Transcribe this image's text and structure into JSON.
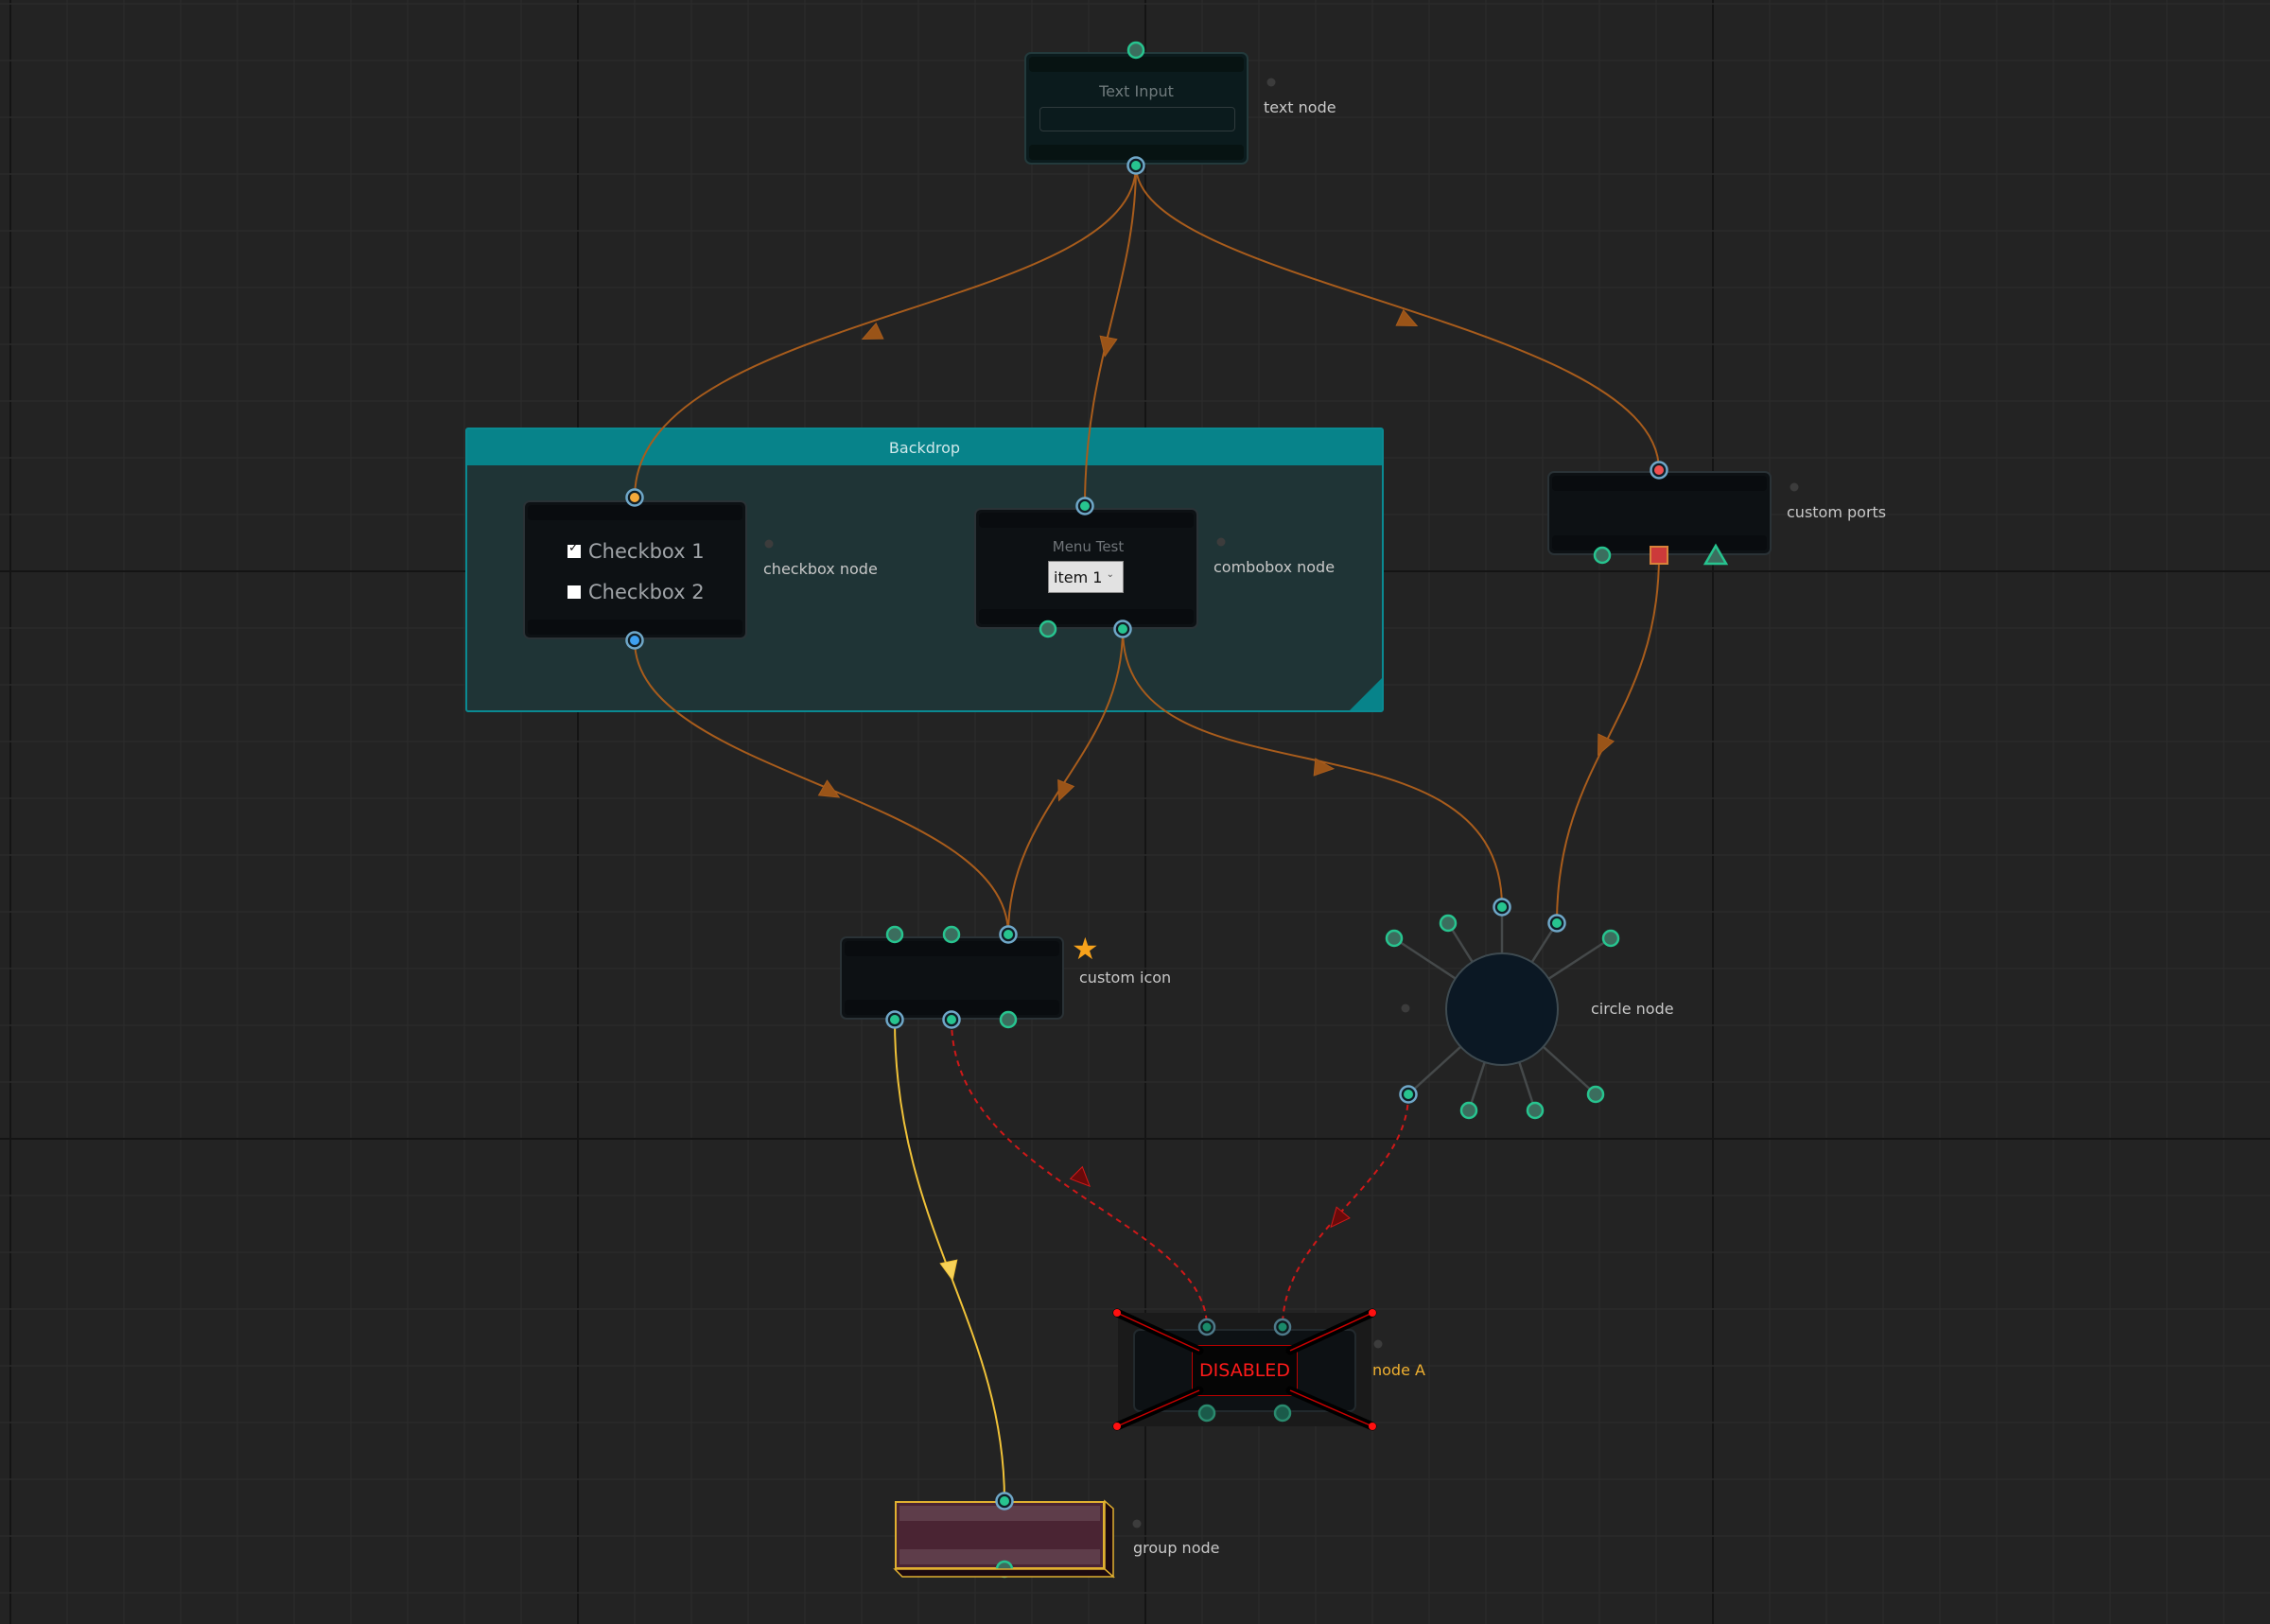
{
  "canvas": {
    "background": "#232323",
    "grid_minor_color": "#2b2b2b",
    "grid_major_color": "#141414"
  },
  "colors": {
    "pipe_orange": "#a85c1c",
    "pipe_yellow": "#f0c238",
    "pipe_disabled": "#d01818",
    "port_green": "#27c48f",
    "port_fill_dark": "#3b6e5e",
    "port_ring_blue": "#6fa7c8",
    "port_orange": "#f5a93a",
    "port_blue": "#3ea0f0",
    "port_red": "#f05050",
    "backdrop_header": "#07838a",
    "disabled_red": "#ff1a1a",
    "selected_label": "#f0b030",
    "star": "#f7a21b"
  },
  "backdrop": {
    "title": "Backdrop"
  },
  "nodes": {
    "text_node": {
      "label": "text node",
      "widget_title": "Text Input",
      "input_value": ""
    },
    "checkbox_node": {
      "label": "checkbox node",
      "checkboxes": [
        {
          "text": "Checkbox 1",
          "checked": true
        },
        {
          "text": "Checkbox 2",
          "checked": false
        }
      ]
    },
    "combobox_node": {
      "label": "combobox node",
      "widget_title": "Menu Test",
      "selected": "item 1"
    },
    "custom_ports_node": {
      "label": "custom ports"
    },
    "custom_icon_node": {
      "label": "custom icon",
      "icon": "star-icon"
    },
    "circle_node": {
      "label": "circle node"
    },
    "node_a": {
      "label": "node A",
      "status": "DISABLED"
    },
    "group_node": {
      "label": "group node"
    }
  }
}
